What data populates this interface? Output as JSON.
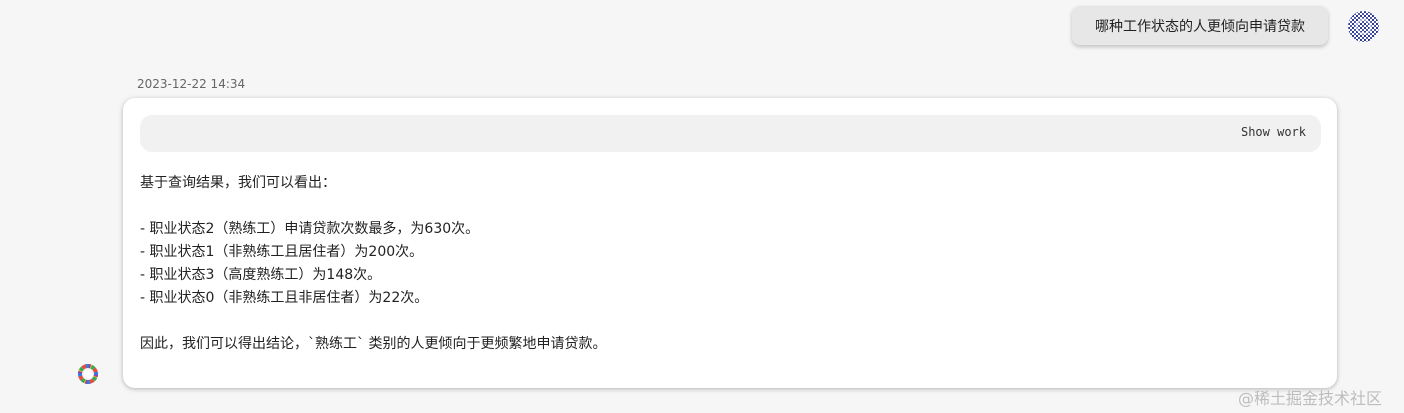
{
  "question": {
    "text": "哪种工作状态的人更倾向申请贷款",
    "avatar_icon": "user-avatar-pattern-icon"
  },
  "answer": {
    "timestamp": "2023-12-22 14:34",
    "show_work_label": "Show work",
    "bot_icon": "colorful-flower-logo-icon",
    "intro": "基于查询结果，我们可以看出：",
    "items": [
      "- 职业状态2（熟练工）申请贷款次数最多，为630次。",
      "- 职业状态1（非熟练工且居住者）为200次。",
      "- 职业状态3（高度熟练工）为148次。",
      "- 职业状态0（非熟练工且非居住者）为22次。"
    ],
    "conclusion": "因此，我们可以得出结论，`熟练工` 类别的人更倾向于更频繁地申请贷款。"
  },
  "watermark": "@稀土掘金技术社区"
}
